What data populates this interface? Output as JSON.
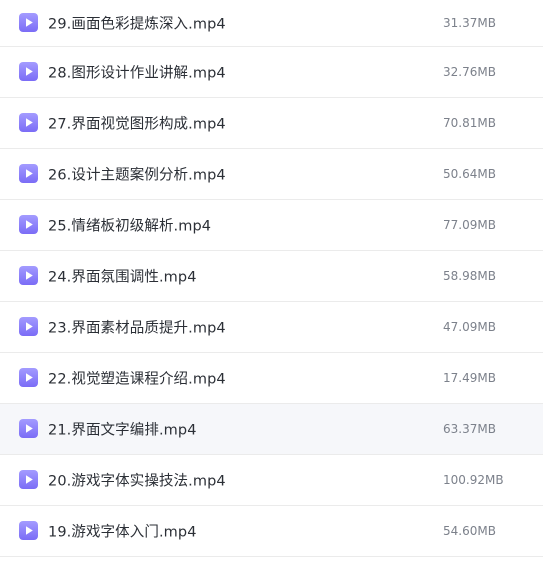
{
  "files": [
    {
      "name": "29.画面色彩提炼深入.mp4",
      "size": "31.37MB",
      "icon": "video-file-icon"
    },
    {
      "name": "28.图形设计作业讲解.mp4",
      "size": "32.76MB",
      "icon": "video-file-icon"
    },
    {
      "name": "27.界面视觉图形构成.mp4",
      "size": "70.81MB",
      "icon": "video-file-icon"
    },
    {
      "name": "26.设计主题案例分析.mp4",
      "size": "50.64MB",
      "icon": "video-file-icon"
    },
    {
      "name": "25.情绪板初级解析.mp4",
      "size": "77.09MB",
      "icon": "video-file-icon"
    },
    {
      "name": "24.界面氛围调性.mp4",
      "size": "58.98MB",
      "icon": "video-file-icon"
    },
    {
      "name": "23.界面素材品质提升.mp4",
      "size": "47.09MB",
      "icon": "video-file-icon"
    },
    {
      "name": "22.视觉塑造课程介绍.mp4",
      "size": "17.49MB",
      "icon": "video-file-icon"
    },
    {
      "name": "21.界面文字编排.mp4",
      "size": "63.37MB",
      "icon": "video-file-icon"
    },
    {
      "name": "20.游戏字体实操技法.mp4",
      "size": "100.92MB",
      "icon": "video-file-icon"
    },
    {
      "name": "19.游戏字体入门.mp4",
      "size": "54.60MB",
      "icon": "video-file-icon"
    }
  ],
  "colors": {
    "icon_top": "#a39bff",
    "icon_bottom": "#7b6cf6",
    "name_text": "#2b2f36",
    "size_text": "#7c818b",
    "row_divider": "#ebebeb",
    "hover_row_background": "#f6f7fa"
  },
  "hovered_row_index": 8
}
